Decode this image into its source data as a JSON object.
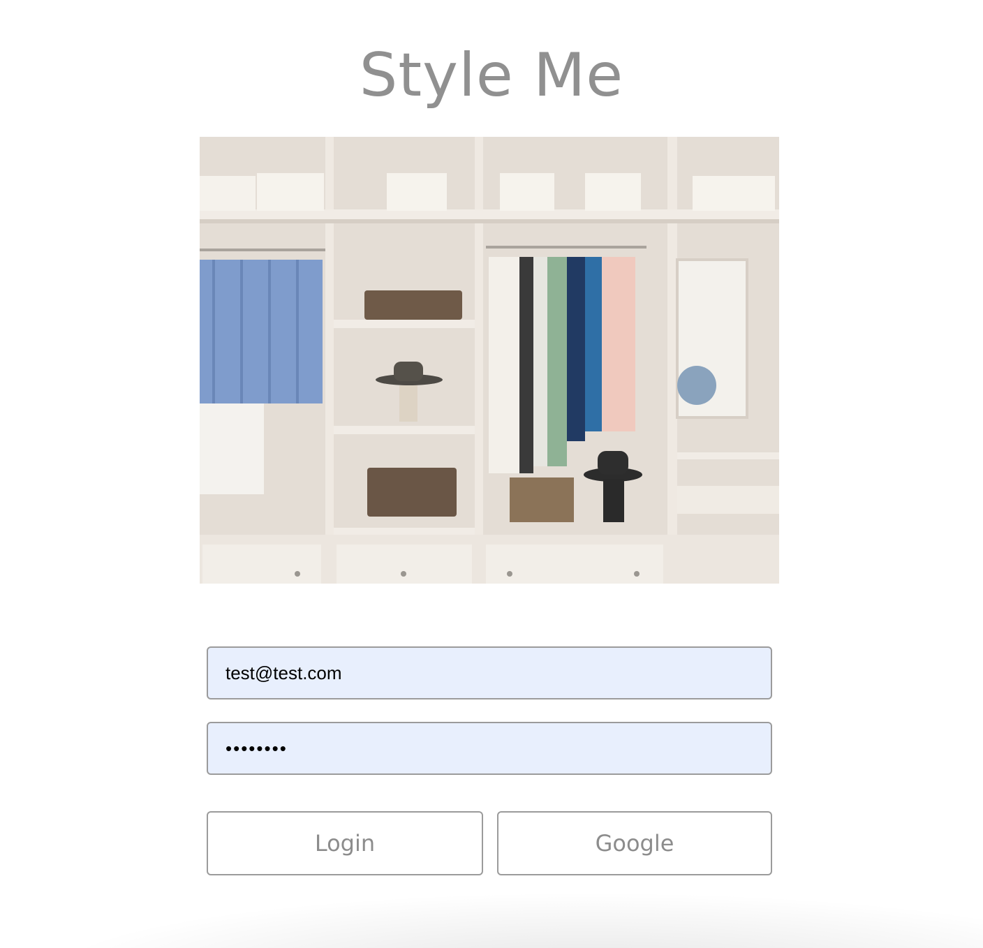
{
  "app": {
    "title": "Style Me"
  },
  "hero_image": {
    "subject": "walk-in closet with shirts, hats, baskets and dresses"
  },
  "form": {
    "email_value": "test@test.com",
    "password_value": "password"
  },
  "buttons": {
    "login_label": "Login",
    "google_label": "Google"
  },
  "colors": {
    "title": "#909090",
    "input_background": "#e8effd",
    "border": "#9b9b9b",
    "button_text": "#8c8c8c"
  }
}
